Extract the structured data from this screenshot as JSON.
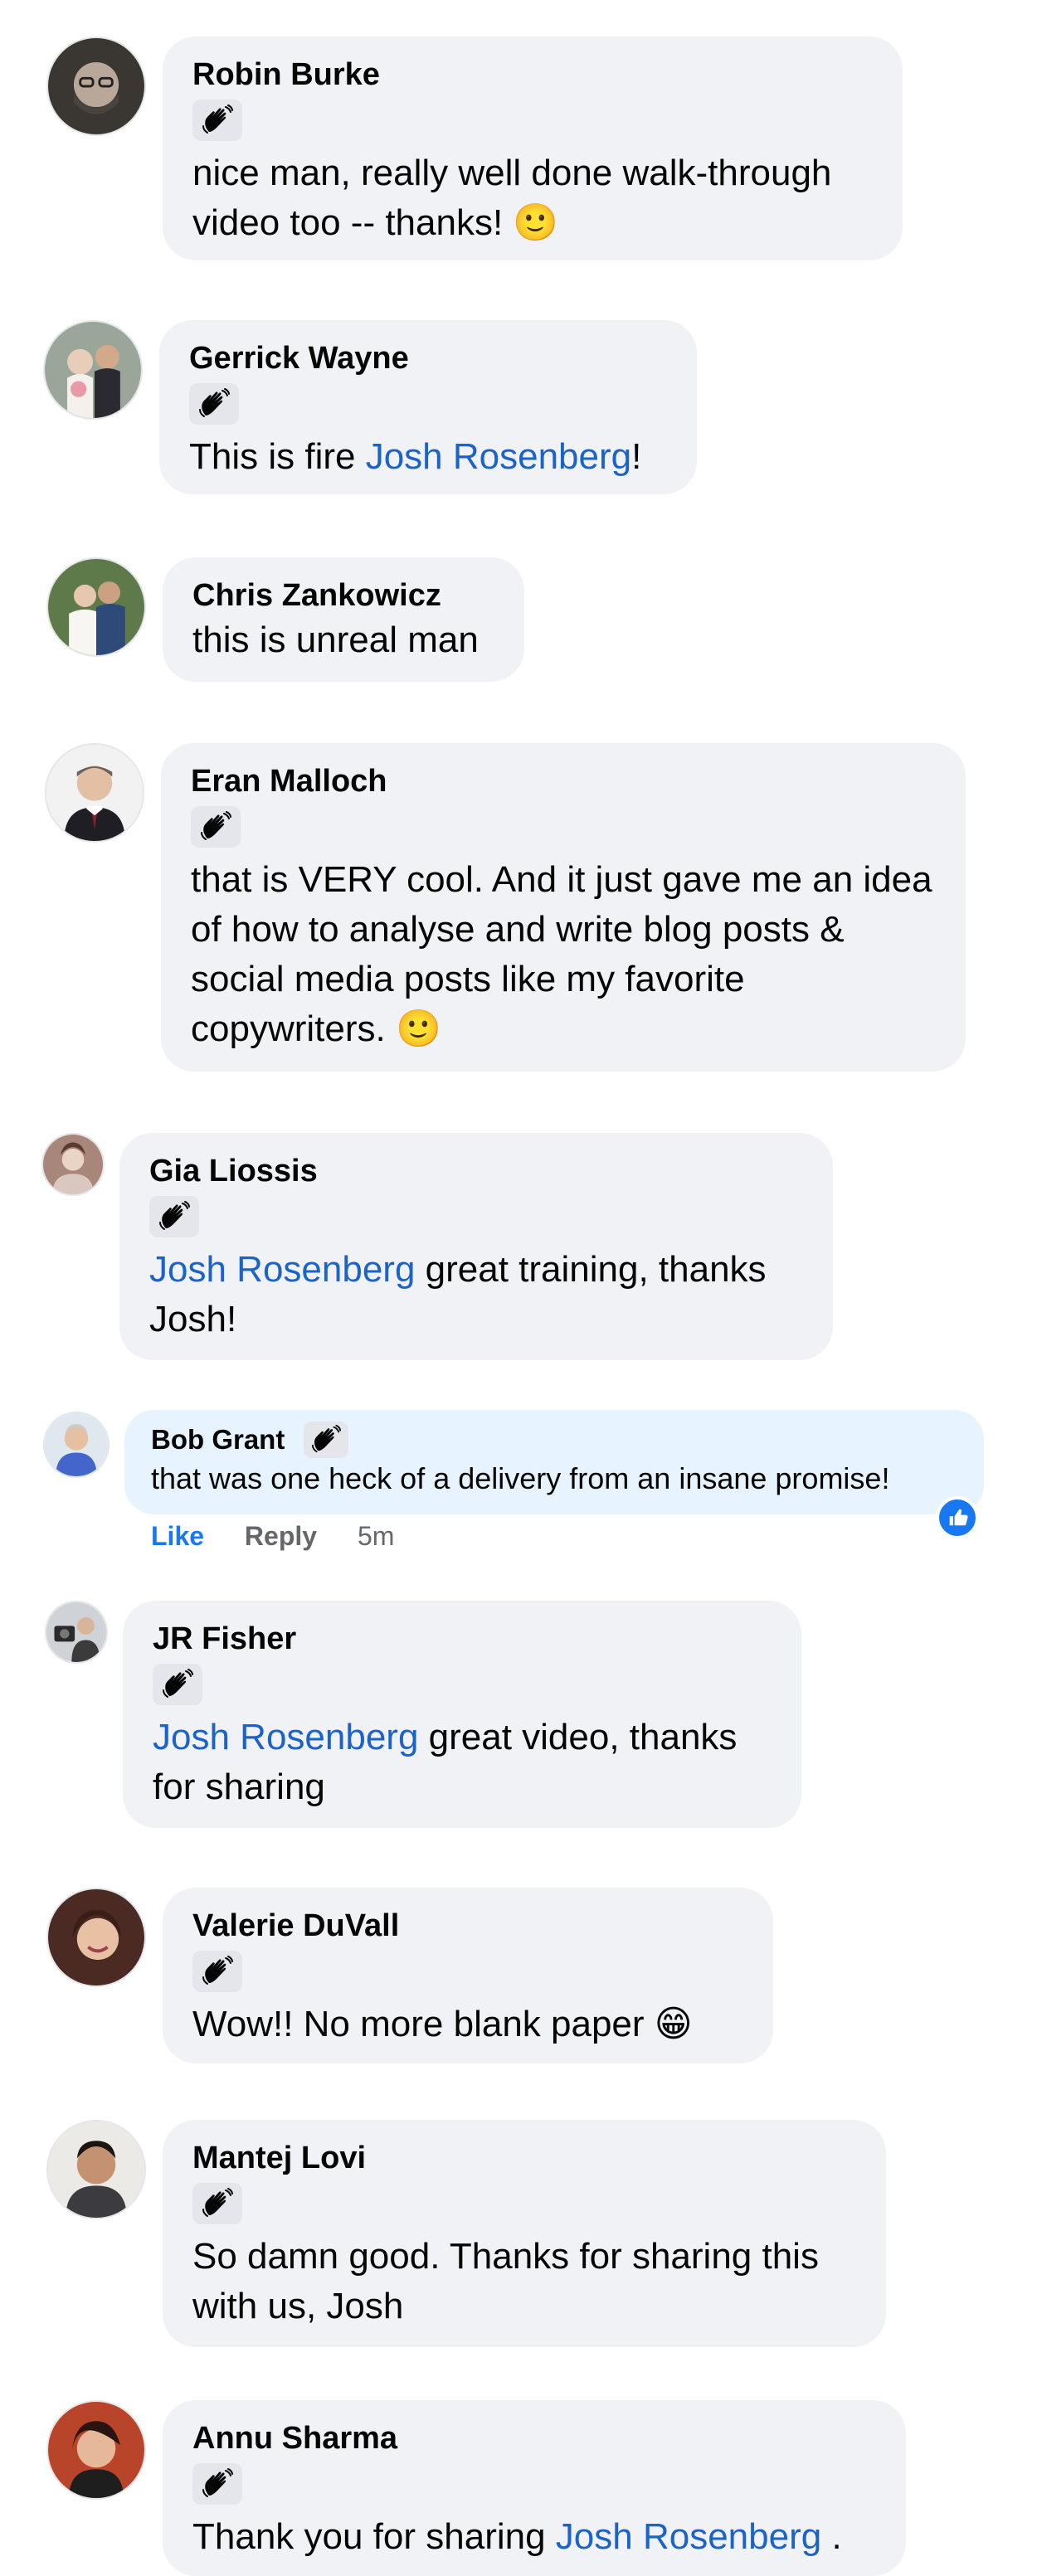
{
  "comments": [
    {
      "name": "Robin Burke",
      "text": "nice man, really well done walk-through video too -- thanks! 🙂"
    },
    {
      "name": "Gerrick Wayne",
      "text_before": "This is fire ",
      "mention": "Josh Rosenberg",
      "text_after": "!"
    },
    {
      "name": "Chris Zankowicz",
      "text": "this is unreal man"
    },
    {
      "name": "Eran Malloch",
      "text": "that is VERY cool. And it just gave me an idea of how to analyse and write blog posts & social media posts like my favorite copywriters. 🙂"
    },
    {
      "name": "Gia Liossis",
      "mention": "Josh Rosenberg",
      "text_after": " great training, thanks Josh!"
    },
    {
      "name": "Bob Grant",
      "text": "that was one heck of a delivery from an insane promise!",
      "actions": {
        "like": "Like",
        "reply": "Reply",
        "time": "5m"
      }
    },
    {
      "name": "JR Fisher",
      "mention": "Josh Rosenberg",
      "text_after": " great video, thanks for sharing"
    },
    {
      "name": "Valerie DuVall",
      "text": "Wow!!  No more blank paper 😁"
    },
    {
      "name": "Mantej Lovi",
      "text": "So damn good. Thanks for sharing this with us, Josh"
    },
    {
      "name": "Annu Sharma",
      "text_before": "Thank you for sharing ",
      "mention": "Josh Rosenberg",
      "text_after": " ."
    }
  ],
  "icons": {
    "badge": "waving-hand-icon",
    "reaction": "thumbs-up-icon"
  },
  "colors": {
    "bubble": "#f0f2f5",
    "highlight": "#e7f3ff",
    "mention": "#1b63c9",
    "like": "#1877f2"
  }
}
